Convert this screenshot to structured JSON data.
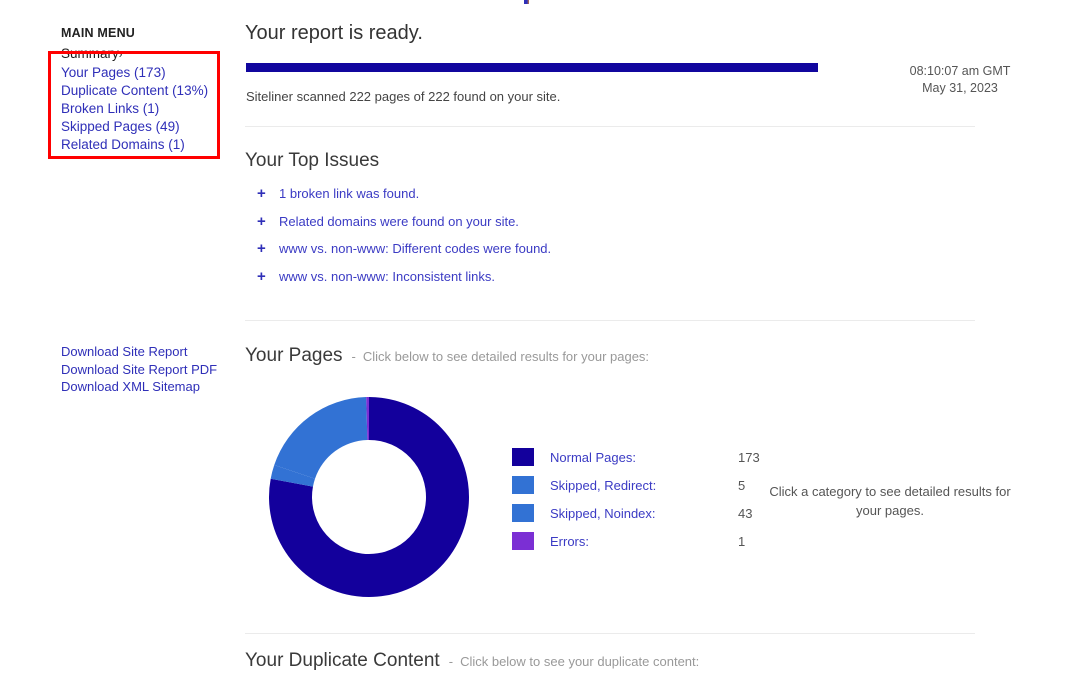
{
  "sidebar": {
    "heading": "MAIN MENU",
    "items": [
      {
        "label": "Summary",
        "chevron": "›",
        "current": true
      },
      {
        "label": "Your Pages (173)",
        "current": false
      },
      {
        "label": "Duplicate Content (13%)",
        "current": false
      },
      {
        "label": "Broken Links (1)",
        "current": false
      },
      {
        "label": "Skipped Pages (49)",
        "current": false
      },
      {
        "label": "Related Domains (1)",
        "current": false
      }
    ],
    "downloads": [
      {
        "label": "Download Site Report"
      },
      {
        "label": "Download Site Report PDF"
      },
      {
        "label": "Download XML Sitemap"
      }
    ]
  },
  "annotation": {
    "color": "#ff0000",
    "shape": "rectangle"
  },
  "main": {
    "title": "Your report is ready.",
    "progress": {
      "percent": 100,
      "fill_color": "#11069e"
    },
    "scan_status": "Siteliner scanned 222 pages of 222 found on your site.",
    "timestamp_time": "08:10:07 am GMT",
    "timestamp_date": "May 31, 2023",
    "issues_heading": "Your Top Issues",
    "issues": [
      {
        "icon": "plus-icon",
        "text": "1 broken link was found."
      },
      {
        "icon": "plus-icon",
        "text": "Related domains were found on your site."
      },
      {
        "icon": "plus-icon",
        "text": "www vs. non-www: Different codes were found."
      },
      {
        "icon": "plus-icon",
        "text": "www vs. non-www: Inconsistent links."
      }
    ],
    "pages_section": {
      "title": "Your Pages",
      "dash": "-",
      "subtitle": "Click below to see detailed results for your pages:",
      "hint": "Click a category to see detailed results for your pages."
    },
    "duplicate_section": {
      "title": "Your Duplicate Content",
      "dash": "-",
      "subtitle": "Click below to see your duplicate content:"
    }
  },
  "chart_data": {
    "type": "pie",
    "variant": "donut",
    "title": "Your Pages",
    "categories": [
      "Normal Pages:",
      "Skipped, Redirect:",
      "Skipped, Noindex:",
      "Errors:"
    ],
    "values": [
      173,
      5,
      43,
      1
    ],
    "colors": [
      "#13009c",
      "#3272d4",
      "#3272d4",
      "#7b2fd4"
    ],
    "total": 222,
    "legend_position": "right",
    "start_angle_deg": 0,
    "direction": "clockwise",
    "inner_radius_ratio": 0.57
  }
}
